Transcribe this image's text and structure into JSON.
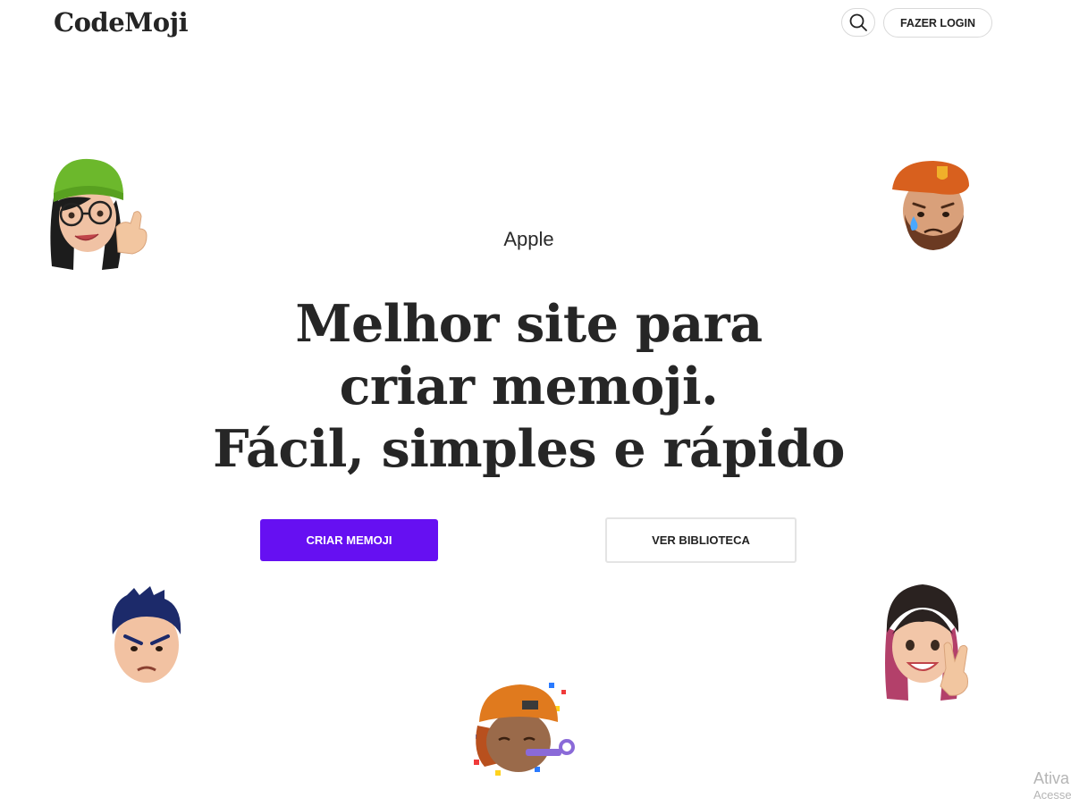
{
  "header": {
    "logo": "CodeMoji",
    "search_icon": "search-icon",
    "login_label": "FAZER LOGIN"
  },
  "hero": {
    "eyebrow": "Apple",
    "headline_lines": [
      "Melhor site para",
      "criar memoji.",
      "Fácil, simples e rápido"
    ],
    "primary_button": "CRIAR MEMOJI",
    "secondary_button": "VER BIBLIOTECA"
  },
  "memojis": [
    "memoji-girl-green-beanie-thumbs-up",
    "memoji-crying-beret",
    "memoji-angry-blue-hair",
    "memoji-party-blower",
    "memoji-girl-peace-sign"
  ],
  "colors": {
    "accent": "#6610f2",
    "text": "#252525",
    "border": "#d9d9d9"
  },
  "watermark": {
    "line1": "Ativa",
    "line2": "Acesse"
  }
}
